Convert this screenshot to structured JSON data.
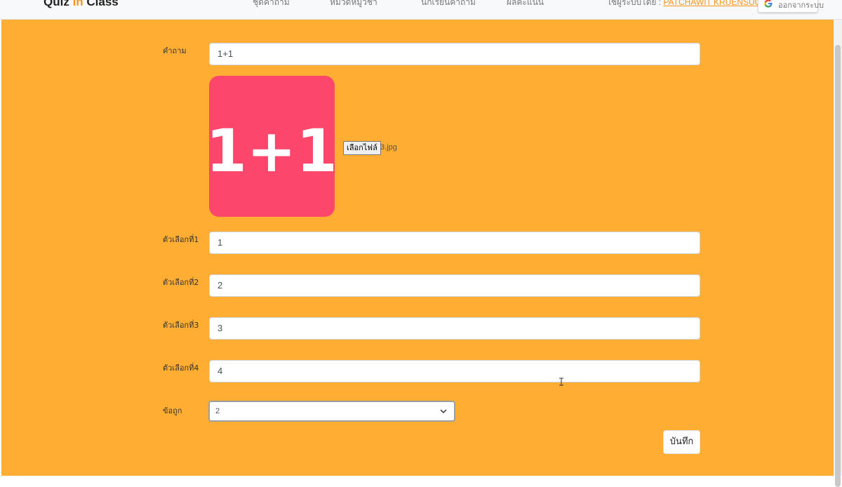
{
  "navbar": {
    "brand_prefix": "Quiz ",
    "brand_highlight": "in",
    "brand_suffix": " Class",
    "links": [
      "ชุดคำถาม",
      "หมวดหมู่วิชา",
      "นักเรียนคำถาม",
      "ผลคะแนน"
    ],
    "user_prefix": "ใช้ผู้ระบบโดย : ",
    "user_name": "PATCHAWIT KRUENSUONTORN",
    "logout_label": "ออกจากระบบ"
  },
  "form": {
    "question_label": "คำถาม",
    "question_value": "1+1",
    "image_text": "1+1",
    "file_button_label": "เลือกไฟล์",
    "file_name": "3.jpg",
    "options": [
      {
        "label": "ตัวเลือกที่1",
        "value": "1"
      },
      {
        "label": "ตัวเลือกที่2",
        "value": "2"
      },
      {
        "label": "ตัวเลือกที่3",
        "value": "3"
      },
      {
        "label": "ตัวเลือกที่4",
        "value": "4"
      }
    ],
    "answer_label": "ข้อถูก",
    "answer_value": "2",
    "save_label": "บันทึก"
  },
  "colors": {
    "background": "#ffad33",
    "image_bg": "#fc466b",
    "brand_accent": "#f7941d"
  }
}
